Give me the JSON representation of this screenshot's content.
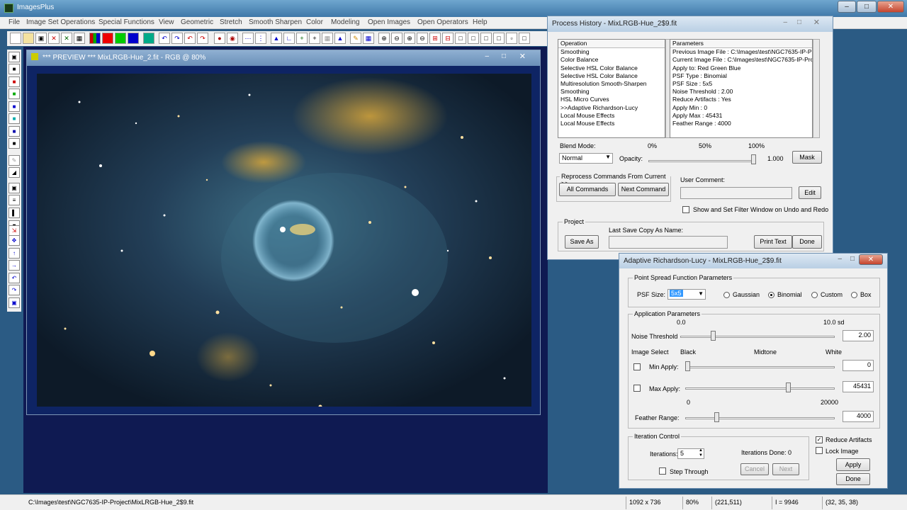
{
  "app": {
    "title": "ImagesPlus"
  },
  "menu": [
    "File",
    "Image Set Operations",
    "Special Functions",
    "View",
    "Geometric",
    "Stretch",
    "Smooth Sharpen",
    "Color",
    "Modeling",
    "Open Images",
    "Open Operators",
    "Help"
  ],
  "preview": {
    "title": "*** PREVIEW *** MixLRGB-Hue_2.fit - RGB @ 80%"
  },
  "history": {
    "title": "Process History - MixLRGB-Hue_2$9.fit",
    "operation_header": "Operation",
    "operations": [
      "Smoothing",
      "Color Balance",
      "Selective HSL Color Balance",
      "Selective HSL Color Balance",
      "Multiresolution Smooth-Sharpen",
      "Smoothing",
      "HSL Micro Curves",
      ">>Adaptive Richardson-Lucy",
      "Local Mouse Effects",
      "Local Mouse Effects"
    ],
    "parameters_header": "Parameters",
    "parameters": [
      "Previous Image File : C:\\Images\\test\\NGC7635-IP-P",
      "Current Image File : C:\\Images\\test\\NGC7635-IP-Pro",
      "Apply to:  Red Green Blue",
      "PSF Type : Binomial",
      "PSF Size : 5x5",
      "Noise Threshold :  2.00",
      "Reduce Artifacts : Yes",
      "Apply Min :  0",
      "Apply Max :  45431",
      "Feather Range : 4000"
    ],
    "blend_mode_label": "Blend Mode:",
    "blend_mode_value": "Normal",
    "opacity_label": "Opacity:",
    "opacity_value": "1.000",
    "opacity_ticks": [
      "0%",
      "50%",
      "100%"
    ],
    "mask_button": "Mask",
    "reprocess_label": "Reprocess Commands From Current >>",
    "all_commands": "All Commands",
    "next_command": "Next Command",
    "user_comment_label": "User Comment:",
    "edit_button": "Edit",
    "show_filter_label": "Show and Set Filter Window on Undo and Redo",
    "project_label": "Project",
    "last_save_label": "Last Save Copy As Name:",
    "save_as": "Save As",
    "print_text": "Print Text",
    "done": "Done"
  },
  "arl": {
    "title": "Adaptive Richardson-Lucy - MixLRGB-Hue_2$9.fit",
    "psf_group": "Point Spread Function Parameters",
    "psf_size_label": "PSF Size:",
    "psf_size_value": "5x5",
    "psf_types": [
      "Gaussian",
      "Binomial",
      "Custom",
      "Box"
    ],
    "app_group": "Application Parameters",
    "noise_scale": [
      "0.0",
      "10.0 sd"
    ],
    "noise_label": "Noise Threshold",
    "noise_value": "2.00",
    "image_select": "Image Select",
    "scale_labels": [
      "Black",
      "Midtone",
      "White"
    ],
    "min_apply": "Min Apply:",
    "min_value": "0",
    "max_apply": "Max Apply:",
    "max_value": "45431",
    "feather_scale": [
      "0",
      "20000"
    ],
    "feather_label": "Feather Range:",
    "feather_value": "4000",
    "iter_group": "Iteration Control",
    "iterations_label": "Iterations:",
    "iterations_value": "5",
    "iterations_done": "Iterations Done: 0",
    "step_through": "Step Through",
    "cancel": "Cancel",
    "next": "Next",
    "reduce_artifacts": "Reduce Artifacts",
    "lock_image": "Lock Image",
    "apply": "Apply",
    "done": "Done"
  },
  "status": {
    "path": "C:\\Images\\test\\NGC7635-IP-Project\\MixLRGB-Hue_2$9.fit",
    "dims": "1092 x 736",
    "zoom": "80%",
    "coords": "(221,511)",
    "intensity": "I = 9946",
    "rgb": "(32, 35, 38)"
  }
}
